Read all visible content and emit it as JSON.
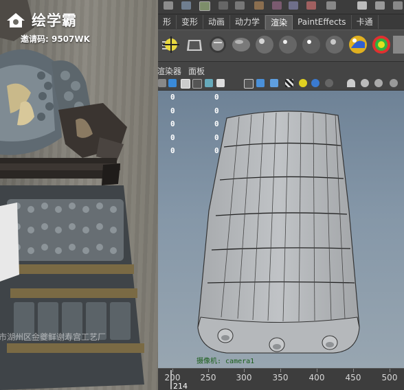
{
  "photo": {
    "logo_text": "绘学霸",
    "invite_label": "邀请码: 9507WK",
    "watermark": "市湖州区金夔鲜谢寿宫工艺厂"
  },
  "maya": {
    "shelf_tabs": [
      {
        "label": "形",
        "active": false
      },
      {
        "label": "变形",
        "active": false
      },
      {
        "label": "动画",
        "active": false
      },
      {
        "label": "动力学",
        "active": false
      },
      {
        "label": "渲染",
        "active": true
      },
      {
        "label": "PaintEffects",
        "active": false
      },
      {
        "label": "卡通",
        "active": false
      }
    ],
    "panel_menu": {
      "renderer": "渲染器",
      "panels": "面板"
    },
    "hud": {
      "values": [
        [
          "0",
          "0"
        ],
        [
          "0",
          "0"
        ],
        [
          "0",
          "0"
        ],
        [
          "0",
          "0"
        ],
        [
          "0",
          "0"
        ]
      ],
      "camera_label": "摄像机: camera1"
    },
    "timeline": {
      "ticks": [
        "200",
        "250",
        "300",
        "350",
        "400",
        "450",
        "500"
      ],
      "current_frame": "214"
    }
  },
  "colors": {
    "viewport_top": "#6e8296",
    "viewport_bottom": "#98a6b1",
    "model_fill": "#b9bcbf",
    "active_tab": "#5a5a5a"
  }
}
